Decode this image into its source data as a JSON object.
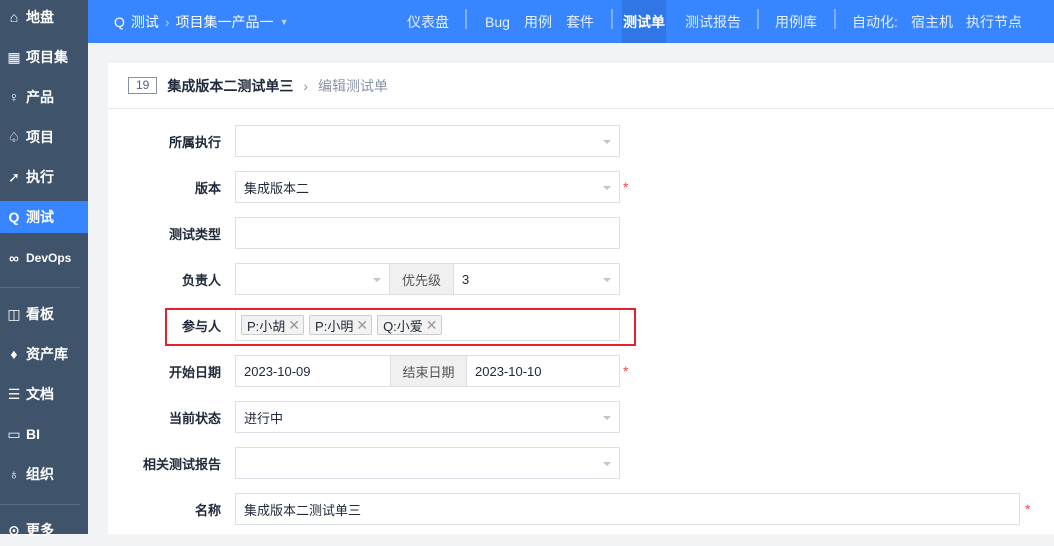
{
  "sidebar": {
    "items": [
      {
        "label": "地盘",
        "icon": "home-icon"
      },
      {
        "label": "项目集",
        "icon": "grid-icon"
      },
      {
        "label": "产品",
        "icon": "bulb-icon"
      },
      {
        "label": "项目",
        "icon": "rocket-icon"
      },
      {
        "label": "执行",
        "icon": "run-icon"
      },
      {
        "label": "测试",
        "icon": "test-icon",
        "active": true
      },
      {
        "label": "DevOps",
        "icon": "infinity-icon"
      },
      {
        "label": "看板",
        "icon": "kanban-icon"
      },
      {
        "label": "资产库",
        "icon": "diamond-icon"
      },
      {
        "label": "文档",
        "icon": "doc-icon"
      },
      {
        "label": "BI",
        "icon": "monitor-icon"
      },
      {
        "label": "组织",
        "icon": "people-icon"
      },
      {
        "label": "更多",
        "icon": "more-icon"
      }
    ]
  },
  "topbar": {
    "module": "测试",
    "program": "项目集一产品一",
    "nav": [
      "仪表盘",
      "Bug",
      "用例",
      "套件",
      "测试单",
      "测试报告",
      "用例库",
      "自动化:",
      "宿主机",
      "执行节点"
    ],
    "active": "测试单"
  },
  "header": {
    "id": "19",
    "title": "集成版本二测试单三",
    "subtitle": "编辑测试单"
  },
  "form": {
    "execution": {
      "label": "所属执行",
      "value": ""
    },
    "build": {
      "label": "版本",
      "value": "集成版本二"
    },
    "type": {
      "label": "测试类型",
      "value": ""
    },
    "owner": {
      "label": "负责人",
      "value": ""
    },
    "priority": {
      "label": "优先级",
      "value": "3"
    },
    "members": {
      "label": "参与人",
      "tags": [
        "P:小胡",
        "P:小明",
        "Q:小爱"
      ]
    },
    "begin": {
      "label": "开始日期",
      "value": "2023-10-09"
    },
    "end": {
      "label": "结束日期",
      "value": "2023-10-10"
    },
    "status": {
      "label": "当前状态",
      "value": "进行中"
    },
    "report": {
      "label": "相关测试报告",
      "value": ""
    },
    "name": {
      "label": "名称",
      "value": "集成版本二测试单三"
    },
    "required_mark": "*"
  }
}
